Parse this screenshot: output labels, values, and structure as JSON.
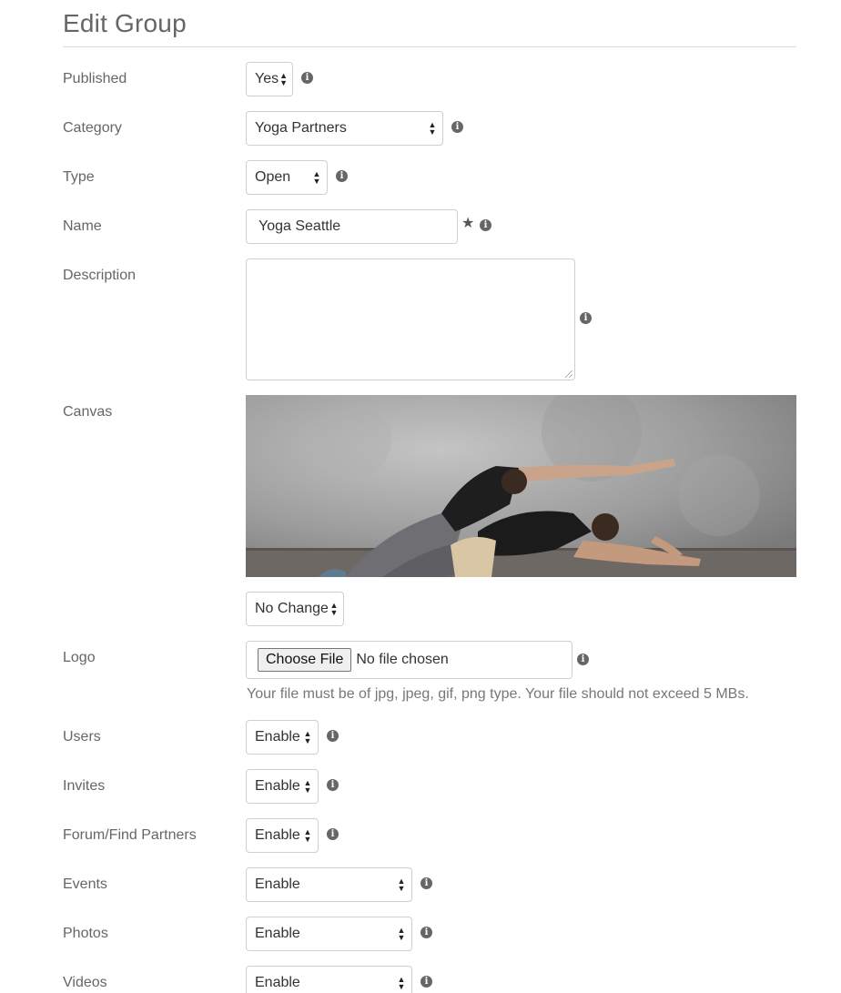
{
  "page_title": "Edit Group",
  "fields": {
    "published": {
      "label": "Published",
      "value": "Yes"
    },
    "category": {
      "label": "Category",
      "value": "Yoga Partners"
    },
    "type": {
      "label": "Type",
      "value": "Open"
    },
    "name": {
      "label": "Name",
      "value": "Yoga Seattle"
    },
    "description": {
      "label": "Description",
      "value": ""
    },
    "canvas": {
      "label": "Canvas",
      "image": "yoga-partners-stretch-photo",
      "select_value": "No Change"
    },
    "logo": {
      "label": "Logo",
      "button_label": "Choose File",
      "status": "No file chosen",
      "help": "Your file must be of jpg, jpeg, gif, png type. Your file should not exceed 5 MBs."
    },
    "users": {
      "label": "Users",
      "value": "Enable"
    },
    "invites": {
      "label": "Invites",
      "value": "Enable"
    },
    "forum": {
      "label": "Forum/Find Partners",
      "value": "Enable"
    },
    "events": {
      "label": "Events",
      "value": "Enable"
    },
    "photos": {
      "label": "Photos",
      "value": "Enable"
    },
    "videos": {
      "label": "Videos",
      "value": "Enable"
    }
  },
  "icons": {
    "info": "info-circle-icon",
    "required": "star-icon"
  }
}
